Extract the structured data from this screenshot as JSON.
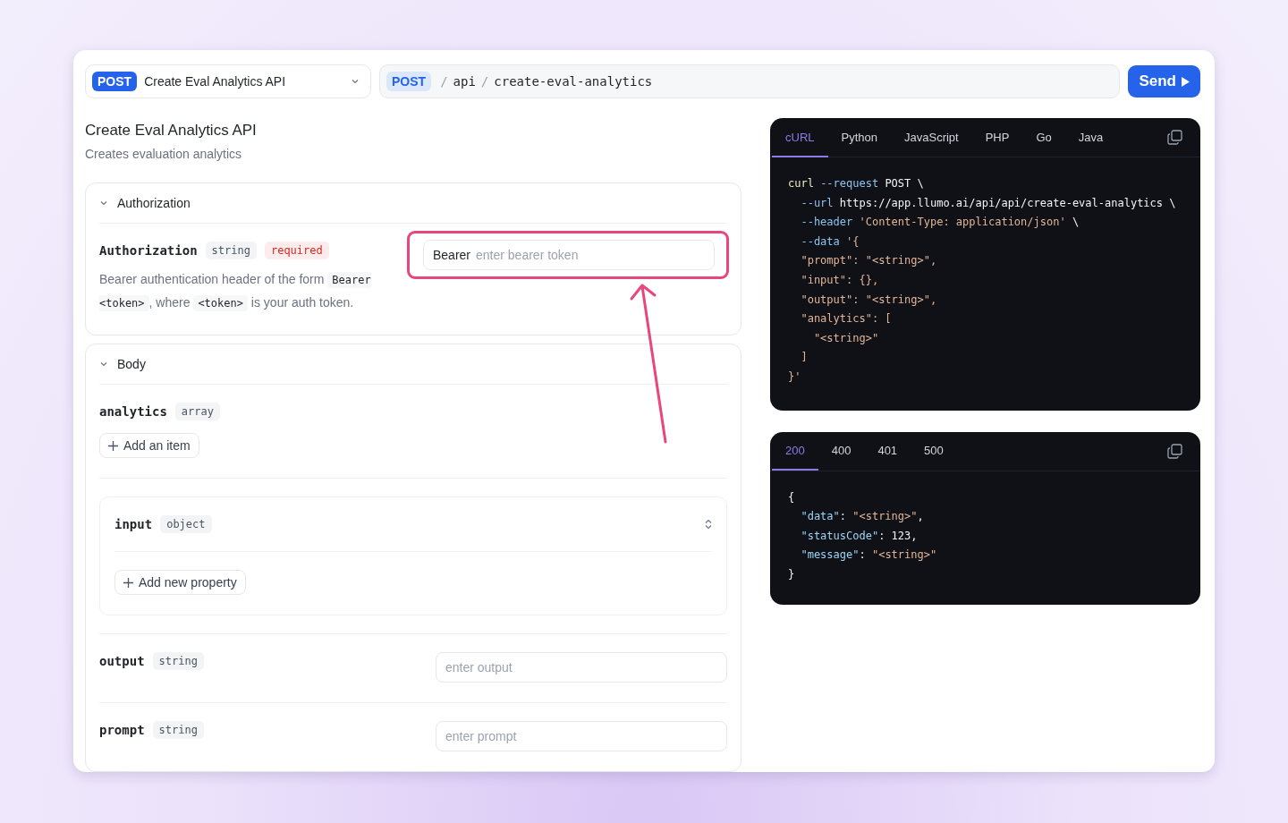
{
  "endpoint_select": {
    "method": "POST",
    "name": "Create Eval Analytics API"
  },
  "url_bar": {
    "method": "POST",
    "path": [
      {
        "text": "/",
        "kind": "separator"
      },
      {
        "text": "api",
        "kind": "segment"
      },
      {
        "text": "/",
        "kind": "separator"
      },
      {
        "text": "create-eval-analytics",
        "kind": "segment"
      }
    ]
  },
  "send_button": {
    "label": "Send"
  },
  "title": "Create Eval Analytics API",
  "subtitle": "Creates evaluation analytics",
  "authorization": {
    "heading": "Authorization",
    "expanded": true,
    "param": {
      "name": "Authorization",
      "type": "string",
      "required_label": "required",
      "description": [
        {
          "text": "Bearer authentication header of the form ",
          "kind": "text"
        },
        {
          "text": "Bearer <token>",
          "kind": "code"
        },
        {
          "text": ", where ",
          "kind": "text"
        },
        {
          "text": "<token>",
          "kind": "code"
        },
        {
          "text": " is your auth token.",
          "kind": "text"
        }
      ],
      "field": {
        "prefix": "Bearer",
        "placeholder": "enter bearer token"
      }
    }
  },
  "body": {
    "heading": "Body",
    "expanded": true,
    "params": [
      {
        "kind": "array",
        "name": "analytics",
        "type": "array",
        "button": "Add an item"
      },
      {
        "kind": "object",
        "name": "input",
        "type": "object",
        "button": "Add new property"
      },
      {
        "kind": "string",
        "name": "output",
        "type": "string",
        "placeholder": "enter output"
      },
      {
        "kind": "string",
        "name": "prompt",
        "type": "string",
        "placeholder": "enter prompt"
      }
    ]
  },
  "request_code": {
    "tabs": [
      {
        "label": "cURL",
        "selected": true
      },
      {
        "label": "Python",
        "selected": false
      },
      {
        "label": "JavaScript",
        "selected": false
      },
      {
        "label": "PHP",
        "selected": false
      },
      {
        "label": "Go",
        "selected": false
      },
      {
        "label": "Java",
        "selected": false
      }
    ],
    "lines": [
      [
        {
          "text": "curl",
          "kind": "cmd"
        },
        {
          "text": " --request",
          "kind": "flag"
        },
        {
          "text": " POST \\",
          "kind": "plain"
        }
      ],
      [
        {
          "text": "  --url",
          "kind": "flag"
        },
        {
          "text": " https://app.llumo.ai/api/api/create-eval-analytics \\",
          "kind": "plain"
        }
      ],
      [
        {
          "text": "  --header",
          "kind": "flag"
        },
        {
          "text": " 'Content-Type: application/json'",
          "kind": "string"
        },
        {
          "text": " \\",
          "kind": "plain"
        }
      ],
      [
        {
          "text": "  --data",
          "kind": "flag"
        },
        {
          "text": " '{",
          "kind": "string"
        }
      ],
      [
        {
          "text": "  \"prompt\": \"<string>\",",
          "kind": "string"
        }
      ],
      [
        {
          "text": "  \"input\": {},",
          "kind": "string"
        }
      ],
      [
        {
          "text": "  \"output\": \"<string>\",",
          "kind": "string"
        }
      ],
      [
        {
          "text": "  \"analytics\": [",
          "kind": "string"
        }
      ],
      [
        {
          "text": "    \"<string>\"",
          "kind": "string"
        }
      ],
      [
        {
          "text": "  ]",
          "kind": "string"
        }
      ],
      [
        {
          "text": "}'",
          "kind": "string"
        }
      ]
    ]
  },
  "response_code": {
    "tabs": [
      {
        "label": "200",
        "selected": true
      },
      {
        "label": "400",
        "selected": false
      },
      {
        "label": "401",
        "selected": false
      },
      {
        "label": "500",
        "selected": false
      }
    ],
    "lines": [
      [
        {
          "text": "{",
          "kind": "plain"
        }
      ],
      [
        {
          "text": "  \"data\"",
          "kind": "key"
        },
        {
          "text": ": ",
          "kind": "plain"
        },
        {
          "text": "\"<string>\"",
          "kind": "string"
        },
        {
          "text": ",",
          "kind": "plain"
        }
      ],
      [
        {
          "text": "  \"statusCode\"",
          "kind": "key"
        },
        {
          "text": ": 123,",
          "kind": "plain"
        }
      ],
      [
        {
          "text": "  \"message\"",
          "kind": "key"
        },
        {
          "text": ": ",
          "kind": "plain"
        },
        {
          "text": "\"<string>\"",
          "kind": "string"
        }
      ],
      [
        {
          "text": "}",
          "kind": "plain"
        }
      ]
    ]
  }
}
